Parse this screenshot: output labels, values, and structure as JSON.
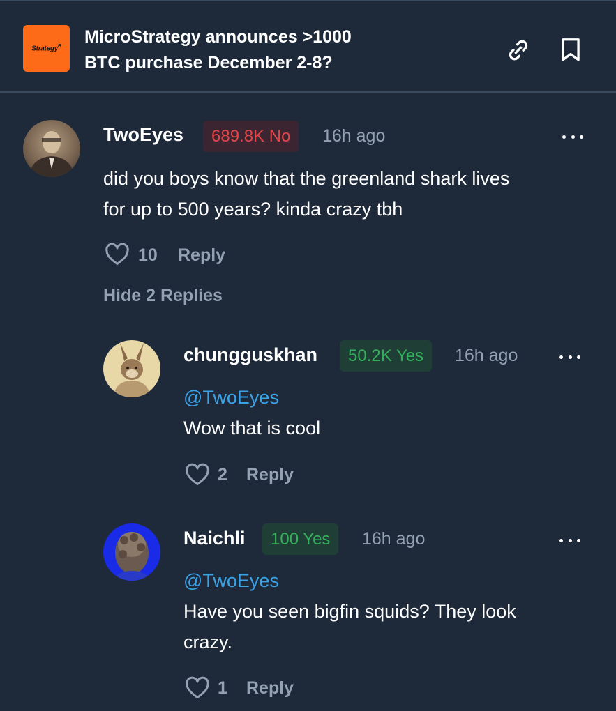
{
  "header": {
    "logo_text": "Strategy",
    "logo_mark": "B",
    "title_line1": "MicroStrategy announces >1000",
    "title_line2": "BTC purchase December 2-8?",
    "link_icon": "link-icon",
    "bookmark_icon": "bookmark-icon"
  },
  "comments": [
    {
      "username": "TwoEyes",
      "position": "689.8K No",
      "position_side": "no",
      "time": "16h ago",
      "text_line1": "did you boys know that the greenland shark lives",
      "text_line2": "for up to 500 years? kinda crazy tbh",
      "likes": "10",
      "reply_label": "Reply",
      "hide_replies_label": "Hide 2 Replies"
    },
    {
      "username": "chungguskhan",
      "position": "50.2K Yes",
      "position_side": "yes",
      "time": "16h ago",
      "mention": "@TwoEyes",
      "text_line1": "Wow that is cool",
      "likes": "2",
      "reply_label": "Reply"
    },
    {
      "username": "Naichli",
      "position": "100 Yes",
      "position_side": "yes",
      "time": "16h ago",
      "mention": "@TwoEyes",
      "text_line1": "Have you seen bigfin squids? They look",
      "text_line2": "crazy.",
      "likes": "1",
      "reply_label": "Reply"
    }
  ],
  "colors": {
    "background": "#1e2a3a",
    "no": "#e2464b",
    "yes": "#34b05c",
    "mention": "#3aa3e8",
    "muted": "#93a1b3",
    "logo": "#fd6a18"
  }
}
